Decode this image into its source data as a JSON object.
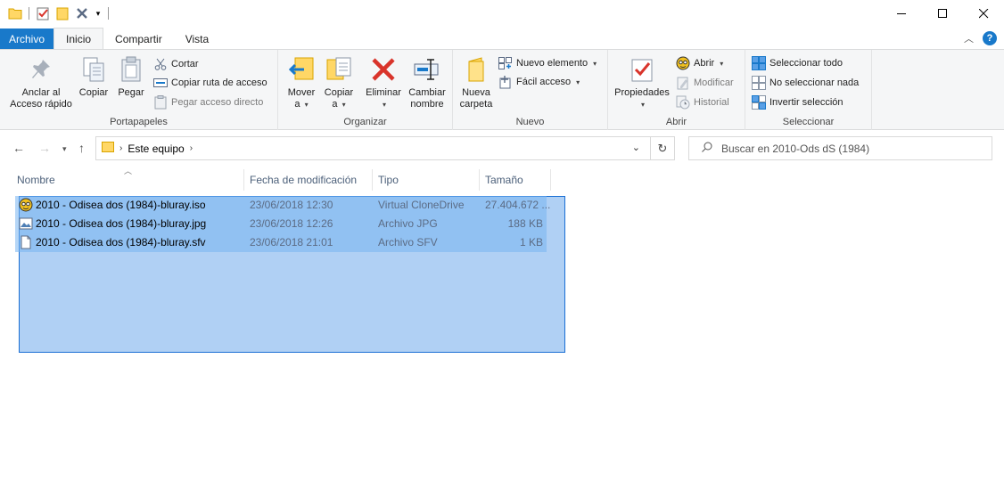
{
  "window": {
    "controls": [
      "minimize",
      "maximize",
      "close"
    ]
  },
  "tabs": {
    "file": "Archivo",
    "home": "Inicio",
    "share": "Compartir",
    "view": "Vista"
  },
  "ribbon": {
    "clipboard": {
      "label": "Portapapeles",
      "pin": "Anclar al\nAcceso rápido",
      "pin_line1": "Anclar al",
      "pin_line2": "Acceso rápido",
      "copy": "Copiar",
      "paste": "Pegar",
      "cut": "Cortar",
      "copy_path": "Copiar ruta de acceso",
      "paste_shortcut": "Pegar acceso directo"
    },
    "organize": {
      "label": "Organizar",
      "move_line1": "Mover",
      "move_line2": "a",
      "copy_line1": "Copiar",
      "copy_line2": "a",
      "delete": "Eliminar",
      "rename_line1": "Cambiar",
      "rename_line2": "nombre"
    },
    "new": {
      "label": "Nuevo",
      "new_folder_line1": "Nueva",
      "new_folder_line2": "carpeta",
      "new_item": "Nuevo elemento",
      "easy_access": "Fácil acceso"
    },
    "open": {
      "label": "Abrir",
      "properties": "Propiedades",
      "open": "Abrir",
      "edit": "Modificar",
      "history": "Historial"
    },
    "select": {
      "label": "Seleccionar",
      "select_all": "Seleccionar todo",
      "select_none": "No seleccionar nada",
      "invert": "Invertir selección"
    }
  },
  "address": {
    "crumb": "Este equipo",
    "search_placeholder": "Buscar en 2010-Ods dS (1984)"
  },
  "columns": {
    "name": "Nombre",
    "date": "Fecha de modificación",
    "type": "Tipo",
    "size": "Tamaño"
  },
  "files": [
    {
      "name": "2010 - Odisea dos (1984)-bluray.iso",
      "date": "23/06/2018 12:30",
      "type": "Virtual CloneDrive",
      "size": "27.404.672 ...",
      "icon": "clonedrive-sheep-icon"
    },
    {
      "name": "2010 - Odisea dos (1984)-bluray.jpg",
      "date": "23/06/2018 12:26",
      "type": "Archivo JPG",
      "size": "188 KB",
      "icon": "image-file-icon"
    },
    {
      "name": "2010 - Odisea dos (1984)-bluray.sfv",
      "date": "23/06/2018 21:01",
      "type": "Archivo SFV",
      "size": "1 KB",
      "icon": "blank-file-icon"
    }
  ],
  "colors": {
    "accent": "#1979ca",
    "selection": "#1a6fd4",
    "ribbon_bg": "#f5f6f7"
  }
}
